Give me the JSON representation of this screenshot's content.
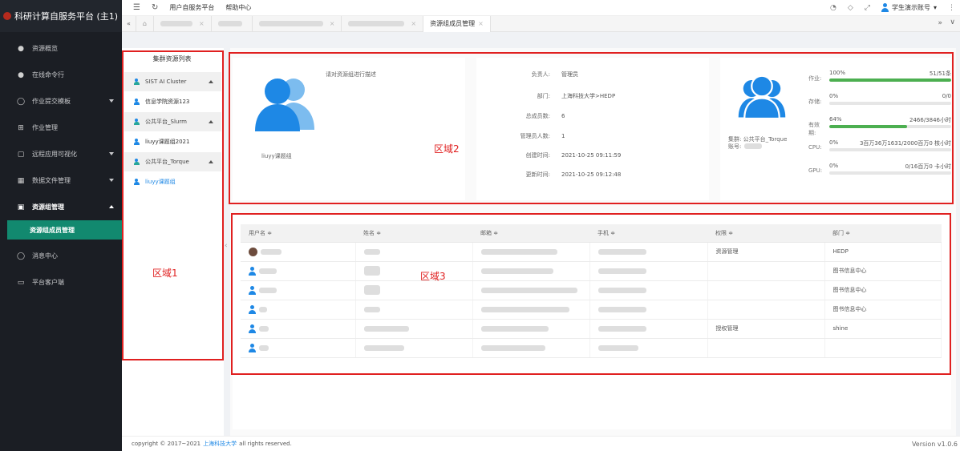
{
  "app": {
    "title": "科研计算自服务平台 (主1)"
  },
  "sidebar": {
    "items": [
      {
        "label": "资源概览",
        "icon": "dashboard-icon"
      },
      {
        "label": "在线命令行",
        "icon": "terminal-icon"
      },
      {
        "label": "作业提交模板",
        "icon": "template-icon"
      },
      {
        "label": "作业管理",
        "icon": "job-icon"
      },
      {
        "label": "远程应用可视化",
        "icon": "monitor-icon"
      },
      {
        "label": "数据文件管理",
        "icon": "folder-icon"
      },
      {
        "label": "资源组管理",
        "icon": "group-icon"
      },
      {
        "label": "资源组成员管理",
        "icon": ""
      },
      {
        "label": "消息中心",
        "icon": "bell-icon"
      },
      {
        "label": "平台客户端",
        "icon": "client-icon"
      }
    ]
  },
  "topbar": {
    "links": [
      "用户自服务平台",
      "帮助中心"
    ],
    "user": "学生演示账号"
  },
  "tabs": {
    "active": "资源组成员管理"
  },
  "regions": {
    "r1": "区域1",
    "r2": "区域2",
    "r3": "区域3"
  },
  "cluster": {
    "title": "集群资源列表",
    "groups": [
      {
        "name": "SIST AI Cluster",
        "items": [
          "信息学院资源123"
        ]
      },
      {
        "name": "公共平台_Slurm",
        "items": [
          "liuyy课题组2021"
        ]
      },
      {
        "name": "公共平台_Torque",
        "items": [
          "liuyy课题组"
        ]
      }
    ]
  },
  "group_card": {
    "name": "liuyy课题组",
    "desc": "请对资源组进行描述"
  },
  "group_info": {
    "rows": [
      {
        "k": "负责人:",
        "v": "管理员"
      },
      {
        "k": "部门:",
        "v": "上海科技大学>HEDP"
      },
      {
        "k": "总成员数:",
        "v": "6"
      },
      {
        "k": "管理员人数:",
        "v": "1"
      },
      {
        "k": "创建时间:",
        "v": "2021-10-25 09:11:59"
      },
      {
        "k": "更新时间:",
        "v": "2021-10-25 09:12:48"
      }
    ]
  },
  "quota": {
    "cluster_label": "集群: 公共平台_Torque",
    "account_label": "账号:",
    "stats": [
      {
        "label": "作业:",
        "pct": "100%",
        "value": "51/51条",
        "fraction": 1.0
      },
      {
        "label": "存储:",
        "pct": "0%",
        "value": "0/0",
        "fraction": 0.0
      },
      {
        "label": "有效期:",
        "pct": "64%",
        "value": "2466/3846小时",
        "fraction": 0.64
      },
      {
        "label": "CPU:",
        "pct": "0%",
        "value": "3百万36万1631/2000百万0 核小时",
        "fraction": 0.0
      },
      {
        "label": "GPU:",
        "pct": "0%",
        "value": "0/16百万0 卡小时",
        "fraction": 0.0
      }
    ]
  },
  "members": {
    "headers": [
      "用户名 ≑",
      "姓名 ≑",
      "邮箱 ≑",
      "手机 ≑",
      "权限 ≑",
      "部门 ≑"
    ],
    "rows": [
      {
        "perm": "资源管理",
        "dept": "HEDP"
      },
      {
        "perm": "",
        "dept": "图书信息中心"
      },
      {
        "perm": "",
        "dept": "图书信息中心"
      },
      {
        "perm": "",
        "dept": "图书信息中心"
      },
      {
        "perm": "授权管理",
        "dept": "shine"
      },
      {
        "perm": "",
        "dept": ""
      }
    ]
  },
  "footer": {
    "prefix": "copyright © 2017~2021",
    "link": "上海科技大学",
    "suffix": "all rights reserved.",
    "version": "Version v1.0.6"
  },
  "colors": {
    "accent": "#12896f",
    "primary": "#1e88e5",
    "highlight": "#e02020",
    "progress": "#4caf50"
  }
}
